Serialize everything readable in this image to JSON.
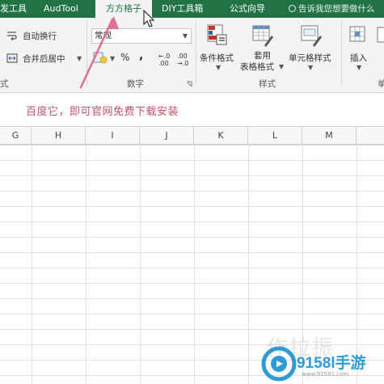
{
  "tabs": [
    {
      "label": "发工具",
      "active": false
    },
    {
      "label": "AudTool",
      "active": false
    },
    {
      "label": "方方格子",
      "active": true
    },
    {
      "label": "DIY工具箱",
      "active": false
    },
    {
      "label": "公式向导",
      "active": false
    }
  ],
  "tell_me": "告诉我您想要做什么",
  "ribbon": {
    "wrap_text": "自动换行",
    "merge_center": "合并后居中",
    "number_format": "常规",
    "percent_symbol": "%",
    "comma_symbol": ",",
    "inc_decimal": "←.0 .00",
    "dec_decimal": ".00 →.0",
    "conditional_format": "条件格式",
    "table_format_1": "套用",
    "table_format_2": "表格格式",
    "cell_styles": "单元格样式",
    "insert": "插入",
    "groups": {
      "alignment": "式",
      "number": "数字",
      "styles": "样式",
      "cells": "单"
    }
  },
  "annotation": "百度它，即可官网免费下载安装",
  "columns": [
    "G",
    "H",
    "I",
    "J",
    "K",
    "L",
    "M"
  ],
  "watermark": {
    "faded": "作拉振",
    "brand": "9158l手游",
    "url": "www.91581.com"
  },
  "colors": {
    "ribbon_green": "#217346",
    "annotation_pink": "#c2526a",
    "watermark_blue": "#2e9bd6"
  }
}
